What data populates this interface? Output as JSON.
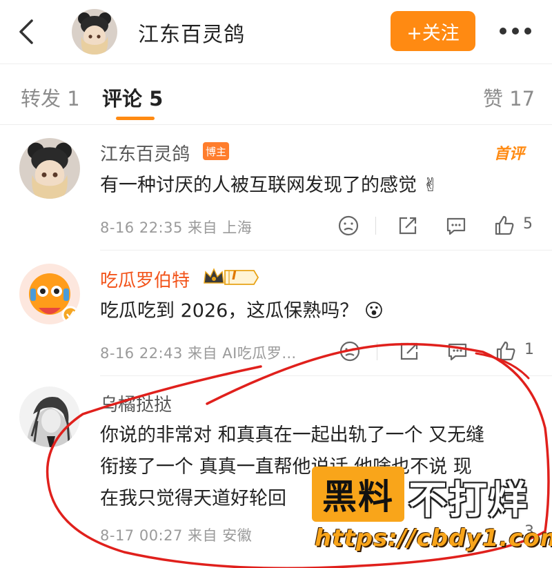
{
  "header": {
    "title": "江东百灵鸽",
    "follow_label": "+关注",
    "back_icon": "chevron-left-icon",
    "more_icon": "more-dots-icon"
  },
  "tabs": [
    {
      "label": "转发 1"
    },
    {
      "label": "评论 5"
    },
    {
      "label": "赞 17"
    }
  ],
  "comments": [
    {
      "name": "江东百灵鸽",
      "badge": "博主",
      "tag": "首评",
      "text": "有一种讨厌的人被互联网发现了的感觉 ✌",
      "meta": "8-16 22:35  来自 上海",
      "likes": "5"
    },
    {
      "name": "吃瓜罗伯特",
      "vip_badge": "I",
      "text": "吃瓜吃到 2026，这瓜保熟吗？ 😮",
      "meta": "8-16 22:43  来自 AI吃瓜罗…",
      "likes": "1"
    },
    {
      "name": "乌橘挞挞",
      "text_lines": [
        "你说的非常对 和真真在一起出轨了一个 又无缝",
        "衔接了一个 真真一直帮他说话 他啥也不说 现",
        "在我只觉得天道好轮回"
      ],
      "meta": "8-17 00:27  来自 安徽",
      "likes": "3"
    }
  ],
  "watermark": {
    "black_text": "黑料",
    "white_text": "不打烊",
    "url": "https://cbdy1.com"
  },
  "colors": {
    "accent": "#ff8a12",
    "vip_name": "#f2541b",
    "annotation_red": "#e0201c"
  }
}
